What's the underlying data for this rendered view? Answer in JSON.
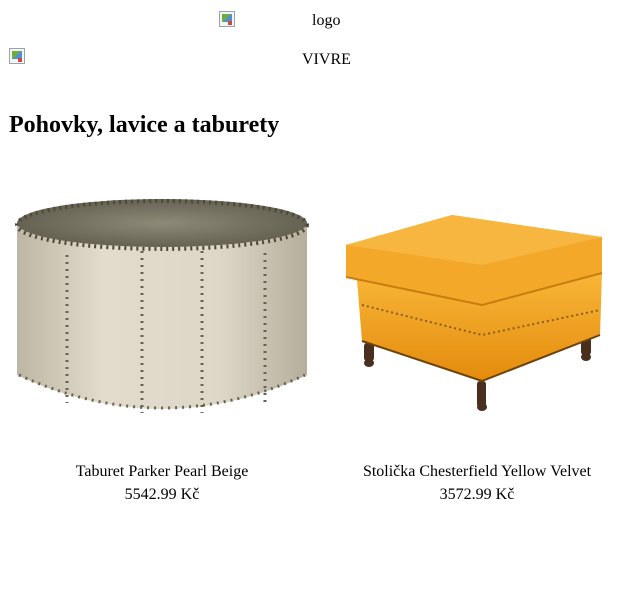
{
  "header": {
    "logo_alt": "logo",
    "brand_alt": "VIVRE"
  },
  "category": {
    "title": "Pohovky, lavice a taburety"
  },
  "products": [
    {
      "name": "Taburet Parker Pearl Beige",
      "price": "5542.99 Kč"
    },
    {
      "name": "Stolička Chesterfield Yellow Velvet",
      "price": "3572.99 Kč"
    }
  ],
  "colors": {
    "pouf_fabric": "#d9d3c3",
    "pouf_top": "#7e7a66",
    "ottoman_velvet": "#f2a21b",
    "legs": "#4a2f1e"
  }
}
